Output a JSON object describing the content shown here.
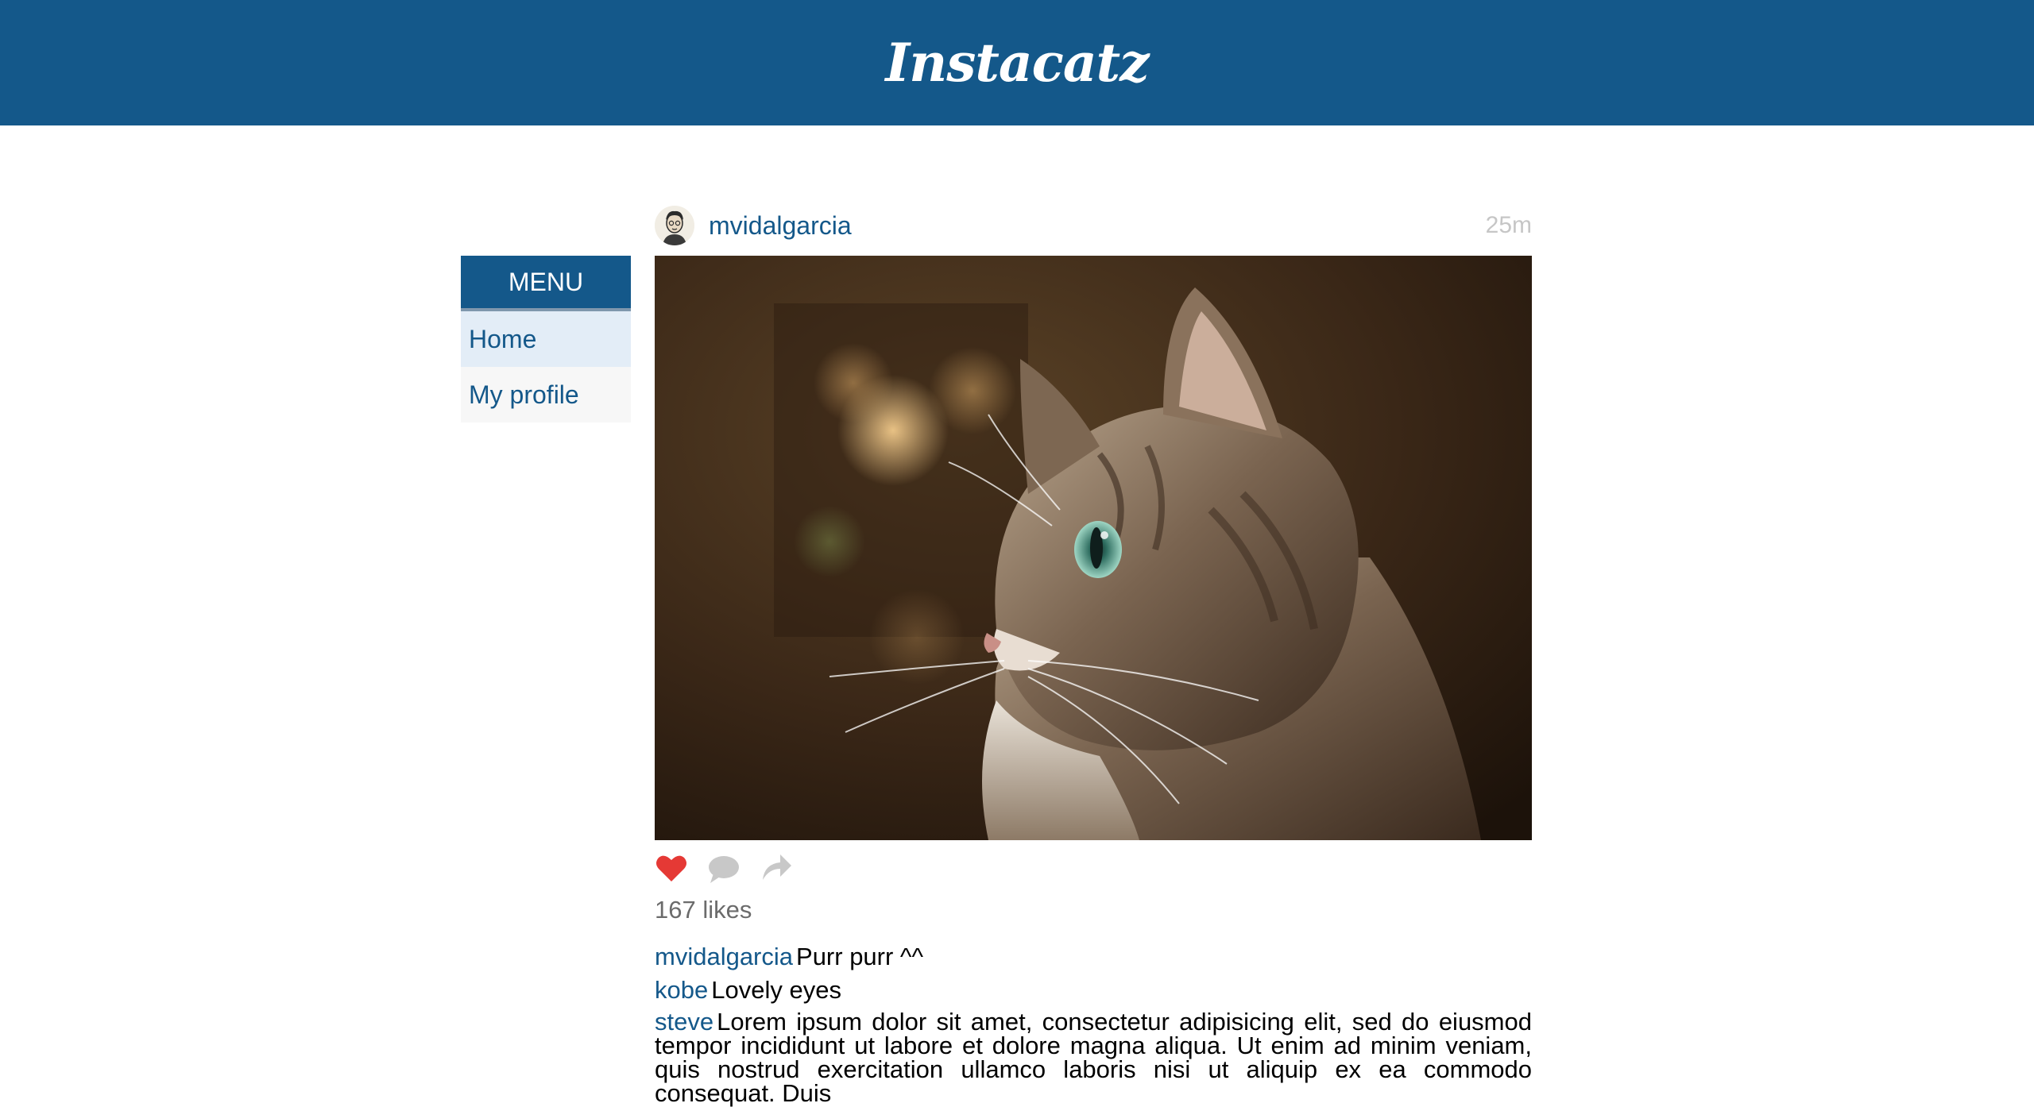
{
  "app": {
    "title": "Instacatz"
  },
  "menu": {
    "header": "MENU",
    "items": [
      {
        "label": "Home",
        "active": true
      },
      {
        "label": "My profile",
        "active": false
      }
    ]
  },
  "post": {
    "username": "mvidalgarcia",
    "time": "25m",
    "photo_alt": "tabby-cat-photo",
    "likes": "167 likes",
    "liked": true,
    "comments": [
      {
        "user": "mvidalgarcia",
        "text": "Purr purr ^^"
      },
      {
        "user": "kobe",
        "text": "Lovely eyes"
      },
      {
        "user": "steve",
        "text": "Lorem ipsum dolor sit amet, consectetur adipisicing elit, sed do eiusmod tempor incididunt ut labore et dolore magna aliqua. Ut enim ad minim veniam, quis nostrud exercitation ullamco laboris nisi ut aliquip ex ea commodo consequat. Duis"
      }
    ]
  },
  "colors": {
    "brand": "#14588a",
    "like": "#e53935",
    "muted_icon": "#c8c8c8"
  },
  "icons": {
    "like": "heart-icon",
    "comment": "speech-bubble-icon",
    "share": "share-arrow-icon"
  }
}
